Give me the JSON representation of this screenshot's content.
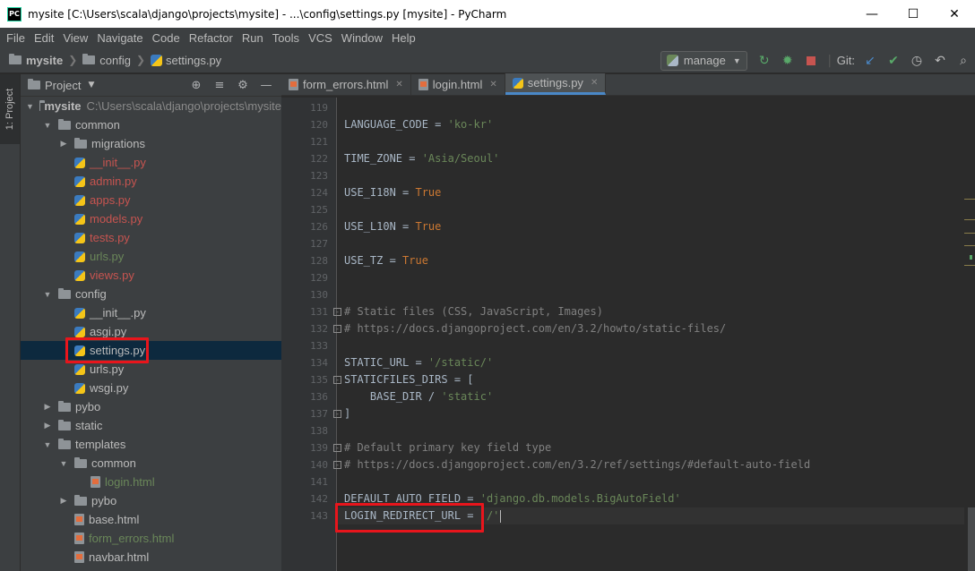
{
  "window": {
    "title": "mysite [C:\\Users\\scala\\django\\projects\\mysite] - ...\\config\\settings.py [mysite] - PyCharm",
    "app_icon": "PC"
  },
  "menu": [
    "File",
    "Edit",
    "View",
    "Navigate",
    "Code",
    "Refactor",
    "Run",
    "Tools",
    "VCS",
    "Window",
    "Help"
  ],
  "breadcrumb": {
    "root": "mysite",
    "folder": "config",
    "file": "settings.py"
  },
  "toolbar": {
    "run_config": "manage",
    "git_label": "Git:"
  },
  "sidebar_tab": "1: Project",
  "project_panel": {
    "title": "Project"
  },
  "tree": [
    {
      "label": "mysite",
      "path": "C:\\Users\\scala\\django\\projects\\mysite",
      "type": "folder",
      "depth": 0,
      "expanded": true
    },
    {
      "label": "common",
      "type": "folder",
      "depth": 1,
      "expanded": true
    },
    {
      "label": "migrations",
      "type": "folder",
      "depth": 2,
      "expanded": false
    },
    {
      "label": "__init__.py",
      "type": "py",
      "depth": 2,
      "status": "red"
    },
    {
      "label": "admin.py",
      "type": "py",
      "depth": 2,
      "status": "red"
    },
    {
      "label": "apps.py",
      "type": "py",
      "depth": 2,
      "status": "red"
    },
    {
      "label": "models.py",
      "type": "py",
      "depth": 2,
      "status": "red"
    },
    {
      "label": "tests.py",
      "type": "py",
      "depth": 2,
      "status": "red"
    },
    {
      "label": "urls.py",
      "type": "py",
      "depth": 2,
      "status": "green"
    },
    {
      "label": "views.py",
      "type": "py",
      "depth": 2,
      "status": "red"
    },
    {
      "label": "config",
      "type": "folder",
      "depth": 1,
      "expanded": true
    },
    {
      "label": "__init__.py",
      "type": "py",
      "depth": 2,
      "status": "normal"
    },
    {
      "label": "asgi.py",
      "type": "py",
      "depth": 2,
      "status": "normal"
    },
    {
      "label": "settings.py",
      "type": "py",
      "depth": 2,
      "status": "normal",
      "selected": true
    },
    {
      "label": "urls.py",
      "type": "py",
      "depth": 2,
      "status": "normal"
    },
    {
      "label": "wsgi.py",
      "type": "py",
      "depth": 2,
      "status": "normal"
    },
    {
      "label": "pybo",
      "type": "folder",
      "depth": 1,
      "expanded": false
    },
    {
      "label": "static",
      "type": "folder",
      "depth": 1,
      "expanded": false
    },
    {
      "label": "templates",
      "type": "folder",
      "depth": 1,
      "expanded": true
    },
    {
      "label": "common",
      "type": "folder",
      "depth": 2,
      "expanded": true
    },
    {
      "label": "login.html",
      "type": "html",
      "depth": 3,
      "status": "green"
    },
    {
      "label": "pybo",
      "type": "folder",
      "depth": 2,
      "expanded": false
    },
    {
      "label": "base.html",
      "type": "html",
      "depth": 2,
      "status": "normal"
    },
    {
      "label": "form_errors.html",
      "type": "html",
      "depth": 2,
      "status": "green"
    },
    {
      "label": "navbar.html",
      "type": "html",
      "depth": 2,
      "status": "normal"
    }
  ],
  "tabs": [
    {
      "label": "form_errors.html",
      "type": "html",
      "active": false
    },
    {
      "label": "login.html",
      "type": "html",
      "active": false
    },
    {
      "label": "settings.py",
      "type": "py",
      "active": true
    }
  ],
  "code_lines": [
    {
      "n": "119",
      "segs": []
    },
    {
      "n": "120",
      "segs": [
        [
          "LANGUAGE_CODE = ",
          "n"
        ],
        [
          "'ko-kr'",
          "s"
        ]
      ]
    },
    {
      "n": "121",
      "segs": []
    },
    {
      "n": "122",
      "segs": [
        [
          "TIME_ZONE = ",
          "n"
        ],
        [
          "'Asia/Seoul'",
          "s"
        ]
      ]
    },
    {
      "n": "123",
      "segs": []
    },
    {
      "n": "124",
      "segs": [
        [
          "USE_I18N = ",
          "n"
        ],
        [
          "True",
          "k"
        ]
      ]
    },
    {
      "n": "125",
      "segs": []
    },
    {
      "n": "126",
      "segs": [
        [
          "USE_L10N = ",
          "n"
        ],
        [
          "True",
          "k"
        ]
      ]
    },
    {
      "n": "127",
      "segs": []
    },
    {
      "n": "128",
      "segs": [
        [
          "USE_TZ = ",
          "n"
        ],
        [
          "True",
          "k"
        ]
      ]
    },
    {
      "n": "129",
      "segs": []
    },
    {
      "n": "130",
      "segs": []
    },
    {
      "n": "131",
      "segs": [
        [
          "# Static files (CSS, JavaScript, Images)",
          "c"
        ]
      ],
      "fold": "-"
    },
    {
      "n": "132",
      "segs": [
        [
          "# https://docs.djangoproject.com/en/3.2/howto/static-files/",
          "c"
        ]
      ],
      "fold": "-"
    },
    {
      "n": "133",
      "segs": []
    },
    {
      "n": "134",
      "segs": [
        [
          "STATIC_URL = ",
          "n"
        ],
        [
          "'/static/'",
          "s"
        ]
      ]
    },
    {
      "n": "135",
      "segs": [
        [
          "STATICFILES_DIRS = [",
          "n"
        ]
      ],
      "fold": "-"
    },
    {
      "n": "136",
      "segs": [
        [
          "    BASE_DIR / ",
          "n"
        ],
        [
          "'static'",
          "s"
        ]
      ]
    },
    {
      "n": "137",
      "segs": [
        [
          "]",
          "n"
        ]
      ],
      "fold": "-"
    },
    {
      "n": "138",
      "segs": []
    },
    {
      "n": "139",
      "segs": [
        [
          "# Default primary key field type",
          "c"
        ]
      ],
      "fold": "-"
    },
    {
      "n": "140",
      "segs": [
        [
          "# https://docs.djangoproject.com/en/3.2/ref/settings/#default-auto-field",
          "c"
        ]
      ],
      "fold": "-"
    },
    {
      "n": "141",
      "segs": []
    },
    {
      "n": "142",
      "segs": [
        [
          "DEFAULT_AUTO_FIELD = ",
          "n"
        ],
        [
          "'django.db.models.BigAutoField'",
          "s"
        ]
      ]
    },
    {
      "n": "143",
      "segs": [
        [
          "LOGIN_REDIRECT_URL = ",
          "n"
        ],
        [
          "'/'",
          "s"
        ]
      ],
      "current": true
    }
  ],
  "colors": {
    "highlight": "#e8151c",
    "selection": "#0d293e",
    "accent": "#4a88c7"
  }
}
